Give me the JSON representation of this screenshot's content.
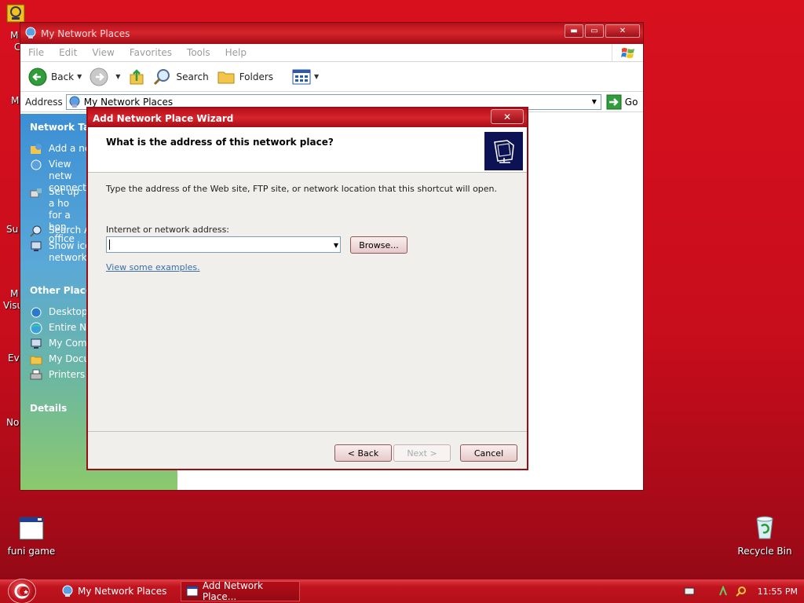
{
  "desktop": {
    "icons": [
      {
        "label": "funi game"
      },
      {
        "label": "Recycle Bin"
      }
    ],
    "partial_labels": [
      "M",
      "C",
      "M",
      "Su",
      "M",
      "Visu",
      "Ev",
      "No"
    ]
  },
  "explorer": {
    "title": "My Network Places",
    "menu": [
      "File",
      "Edit",
      "View",
      "Favorites",
      "Tools",
      "Help"
    ],
    "toolbar": {
      "back": "Back",
      "search": "Search",
      "folders": "Folders"
    },
    "address": {
      "label": "Address",
      "value": "My Network Places",
      "go": "Go"
    },
    "tasks_panel": {
      "network_tasks_title": "Network Task",
      "network_tasks": [
        "Add a ne",
        "View netw connectio",
        "Set up a ho for a hon office",
        "Search A",
        "Show ico networke"
      ],
      "other_places_title": "Other Places",
      "other_places": [
        "Desktop",
        "Entire Ne",
        "My Comp",
        "My Docu",
        "Printers a"
      ],
      "details_title": "Details"
    }
  },
  "wizard": {
    "title": "Add Network Place Wizard",
    "question": "What is the address of this network place?",
    "description": "Type the address of the Web site, FTP site, or network location that this shortcut will open.",
    "field_label": "Internet or network address:",
    "field_value": "",
    "browse": "Browse...",
    "examples_link": "View some examples.",
    "back": "< Back",
    "next": "Next >",
    "cancel": "Cancel"
  },
  "taskbar": {
    "tasks": [
      {
        "label": "My Network Places",
        "active": false
      },
      {
        "label": "Add Network Place...",
        "active": true
      }
    ],
    "clock": "11:55 PM"
  },
  "colors": {
    "desktop": "#c80d1c",
    "title_red": "#b3101b",
    "link_blue": "#3b6ea5"
  }
}
